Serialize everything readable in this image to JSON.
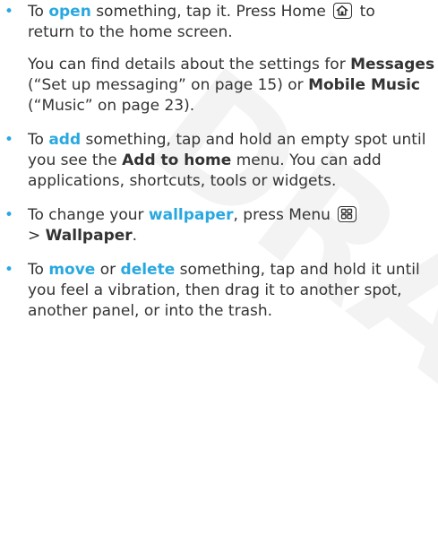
{
  "watermark": "DRAFT",
  "bullet_glyph": "•",
  "accent_color": "#29a8e0",
  "items": [
    {
      "lines": [
        [
          "To ",
          "open",
          " something, tap it. Press Home ",
          "",
          " to"
        ],
        [
          "return to the home screen."
        ]
      ],
      "icon": "home-key-icon"
    },
    {
      "lines": [
        [
          "You can find details about the settings for ",
          "Messages"
        ],
        [
          "(“Set up messaging” on page 15) or ",
          "Mobile Music"
        ],
        [
          "(“Music” on page 23)."
        ]
      ]
    },
    {
      "lines": [
        [
          "To ",
          "add",
          " something, tap and hold an empty spot until"
        ],
        [
          "you see the ",
          "Add to home",
          " menu. You can add"
        ],
        [
          "applications, shortcuts, tools or widgets."
        ]
      ]
    },
    {
      "lines": [
        [
          "To change your ",
          "wallpaper",
          ", press Menu ",
          ""
        ],
        [
          "> ",
          "Wallpaper",
          "."
        ]
      ],
      "icon": "menu-key-icon"
    },
    {
      "lines": [
        [
          "To ",
          "move",
          " or ",
          "delete",
          " something, tap and hold it until"
        ],
        [
          "you feel a vibration, then drag it to another spot,"
        ],
        [
          "another panel, or into the trash."
        ]
      ]
    }
  ]
}
